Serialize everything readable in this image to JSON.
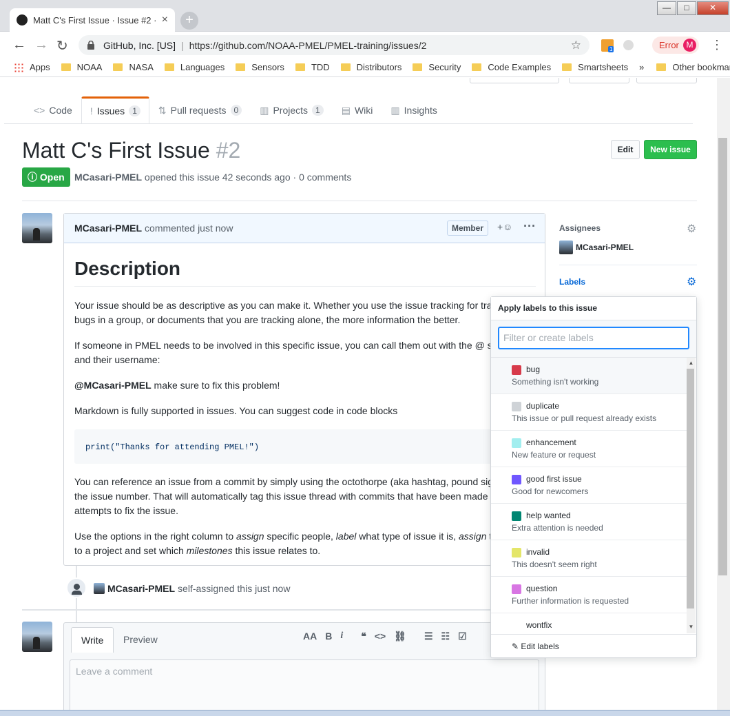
{
  "browser": {
    "tab_title": "Matt C's First Issue · Issue #2 · NOAA-PMEL",
    "tab_close": "×",
    "new_tab": "+",
    "site_identity": "GitHub, Inc. [US]",
    "url": "https://github.com/NOAA-PMEL/PMEL-training/issues/2",
    "extension_badge": "1",
    "error_label": "Error",
    "profile_initial": "M",
    "bookmarks": [
      "Apps",
      "NOAA",
      "NASA",
      "Languages",
      "Sensors",
      "TDD",
      "Distributors",
      "Security",
      "Code Examples",
      "Smartsheets"
    ],
    "more_bookmarks": "»",
    "other_bookmarks": "Other bookmarks"
  },
  "repo_tabs": [
    {
      "label": "Code",
      "icon": "<>"
    },
    {
      "label": "Issues",
      "icon": "!",
      "count": "1",
      "selected": true
    },
    {
      "label": "Pull requests",
      "icon": "⇅",
      "count": "0"
    },
    {
      "label": "Projects",
      "icon": "▥",
      "count": "1"
    },
    {
      "label": "Wiki",
      "icon": "▤"
    },
    {
      "label": "Insights",
      "icon": "▥"
    }
  ],
  "issue": {
    "title": "Matt C's First Issue",
    "number": "#2",
    "edit_label": "Edit",
    "new_issue_label": "New issue",
    "state": "Open",
    "author": "MCasari-PMEL",
    "meta_rest": "opened this issue 42 seconds ago · 0 comments"
  },
  "comment": {
    "author": "MCasari-PMEL",
    "time": "commented just now",
    "badge": "Member",
    "heading": "Description",
    "p1": "Your issue should be as descriptive as you can make it. Whether you use the issue tracking for tracking bugs in a group, or documents that you are tracking alone, the more information the better.",
    "p2": "If someone in PMEL needs to be involved in this specific issue, you can call them out with the @ symbol and their username:",
    "mention": "@MCasari-PMEL",
    "mention_rest": " make sure to fix this problem!",
    "p3": "Markdown is fully supported in issues. You can suggest code in code blocks",
    "code": "print(\"Thanks for attending PMEL!\")",
    "p4": "You can reference an issue from a commit by simply using the octothorpe (aka hashtag, pound sign) and the issue number. That will automatically tag this issue thread with commits that have been made in attempts to fix the issue.",
    "p5a": "Use the options in the right column to ",
    "p5_assign": "assign",
    "p5b": " specific people, ",
    "p5_label": "label",
    "p5c": " what type of issue it is, ",
    "p5_assign2": "assign",
    "p5d": " the issue to a project and set which ",
    "p5_milestones": "milestones",
    "p5e": " this issue relates to."
  },
  "event": {
    "actor": "MCasari-PMEL",
    "text": "self-assigned this just now"
  },
  "new_comment": {
    "write_tab": "Write",
    "preview_tab": "Preview",
    "placeholder": "Leave a comment",
    "tools": [
      "AA",
      "B",
      "i",
      "❝",
      "<>",
      "⛓",
      "☰",
      "☷",
      "☑"
    ]
  },
  "sidebar": {
    "assignees_label": "Assignees",
    "assignee": "MCasari-PMEL",
    "labels_label": "Labels"
  },
  "label_popover": {
    "title": "Apply labels to this issue",
    "filter_placeholder": "Filter or create labels",
    "items": [
      {
        "name": "bug",
        "desc": "Something isn't working",
        "color": "#d73a4a"
      },
      {
        "name": "duplicate",
        "desc": "This issue or pull request already exists",
        "color": "#cfd3d7"
      },
      {
        "name": "enhancement",
        "desc": "New feature or request",
        "color": "#a2eeef"
      },
      {
        "name": "good first issue",
        "desc": "Good for newcomers",
        "color": "#7057ff"
      },
      {
        "name": "help wanted",
        "desc": "Extra attention is needed",
        "color": "#008672"
      },
      {
        "name": "invalid",
        "desc": "This doesn't seem right",
        "color": "#e4e669"
      },
      {
        "name": "question",
        "desc": "Further information is requested",
        "color": "#d876e3"
      },
      {
        "name": "wontfix",
        "desc": "",
        "color": "#ffffff"
      }
    ],
    "edit_labels": "Edit labels"
  }
}
